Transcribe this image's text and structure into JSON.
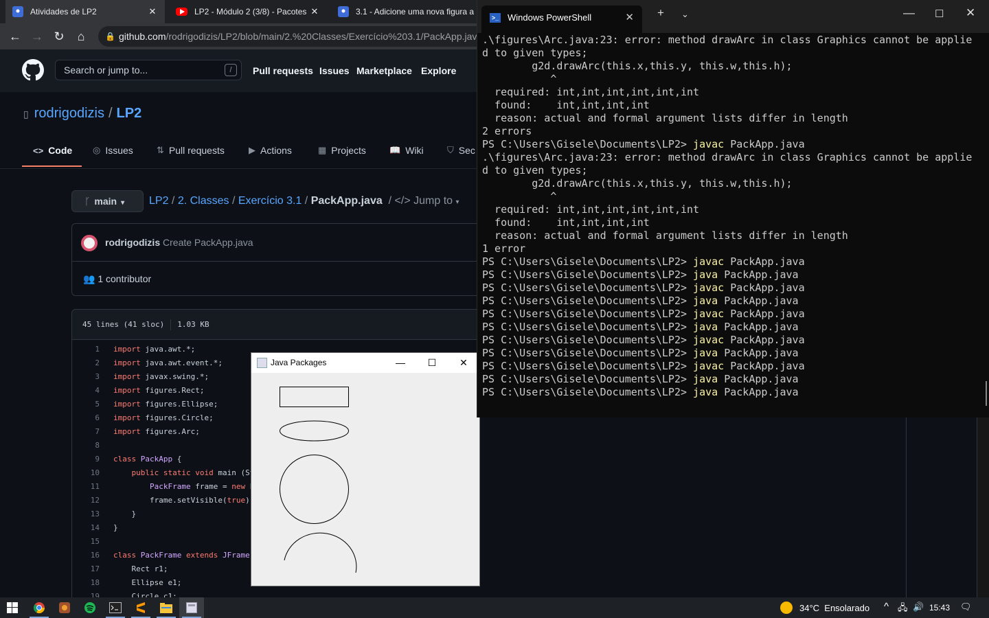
{
  "browser": {
    "tabs": [
      {
        "title": "Atividades de LP2",
        "active": true
      },
      {
        "title": "LP2 - Módulo 2 (3/8) - Pacotes e",
        "active": false
      },
      {
        "title": "3.1 - Adicione uma nova figura a",
        "active": false
      }
    ],
    "url_host": "github.com",
    "url_path": "/rodrigodizis/LP2/blob/main/2.%20Classes/Exercício%203.1/PackApp.java"
  },
  "github": {
    "search_placeholder": "Search or jump to...",
    "search_key": "/",
    "nav": [
      "Pull requests",
      "Issues",
      "Marketplace",
      "Explore"
    ],
    "repo_owner": "rodrigodizis",
    "repo_sep": "/",
    "repo_name": "LP2",
    "tabs": [
      "Code",
      "Issues",
      "Pull requests",
      "Actions",
      "Projects",
      "Wiki",
      "Sec"
    ],
    "branch": "main",
    "breadcrumb": {
      "root": "LP2",
      "dir1": "2. Classes",
      "dir2": "Exercício 3.1",
      "file": "PackApp.java",
      "jump": "Jump to"
    },
    "commit_author": "rodrigodizis",
    "commit_message": "Create PackApp.java",
    "contributors": "1 contributor",
    "file_lines": "45 lines (41 sloc)",
    "file_size": "1.03 KB",
    "code": [
      {
        "n": "1",
        "t": "import java.awt.*;"
      },
      {
        "n": "2",
        "t": "import java.awt.event.*;"
      },
      {
        "n": "3",
        "t": "import javax.swing.*;"
      },
      {
        "n": "4",
        "t": "import figures.Rect;"
      },
      {
        "n": "5",
        "t": "import figures.Ellipse;"
      },
      {
        "n": "6",
        "t": "import figures.Circle;"
      },
      {
        "n": "7",
        "t": "import figures.Arc;"
      },
      {
        "n": "8",
        "t": ""
      },
      {
        "n": "9",
        "t": "class PackApp {"
      },
      {
        "n": "10",
        "t": "    public static void main (St"
      },
      {
        "n": "11",
        "t": "        PackFrame frame = new P"
      },
      {
        "n": "12",
        "t": "        frame.setVisible(true)"
      },
      {
        "n": "13",
        "t": "    }"
      },
      {
        "n": "14",
        "t": "}"
      },
      {
        "n": "15",
        "t": ""
      },
      {
        "n": "16",
        "t": "class PackFrame extends JFrame"
      },
      {
        "n": "17",
        "t": "    Rect r1;"
      },
      {
        "n": "18",
        "t": "    Ellipse e1;"
      },
      {
        "n": "19",
        "t": "    Circle c1;"
      }
    ]
  },
  "java_window": {
    "title": "Java Packages"
  },
  "powershell": {
    "tab_title": "Windows PowerShell",
    "lines": [
      {
        "t": ".\\figures\\Arc.java:23: error: method drawArc in class Graphics cannot be applie"
      },
      {
        "t": "d to given types;"
      },
      {
        "t": "        g2d.drawArc(this.x,this.y, this.w,this.h);"
      },
      {
        "t": "           ^"
      },
      {
        "t": "  required: int,int,int,int,int,int"
      },
      {
        "t": "  found:    int,int,int,int"
      },
      {
        "t": "  reason: actual and formal argument lists differ in length"
      },
      {
        "t": "2 errors"
      },
      {
        "p": "PS C:\\Users\\Gisele\\Documents\\LP2> ",
        "c": "javac",
        "a": " PackApp.java"
      },
      {
        "t": ".\\figures\\Arc.java:23: error: method drawArc in class Graphics cannot be applie"
      },
      {
        "t": "d to given types;"
      },
      {
        "t": "        g2d.drawArc(this.x,this.y, this.w,this.h);"
      },
      {
        "t": "           ^"
      },
      {
        "t": "  required: int,int,int,int,int,int"
      },
      {
        "t": "  found:    int,int,int,int"
      },
      {
        "t": "  reason: actual and formal argument lists differ in length"
      },
      {
        "t": "1 error"
      },
      {
        "p": "PS C:\\Users\\Gisele\\Documents\\LP2> ",
        "c": "javac",
        "a": " PackApp.java"
      },
      {
        "p": "PS C:\\Users\\Gisele\\Documents\\LP2> ",
        "c": "java",
        "a": " PackApp.java"
      },
      {
        "p": "PS C:\\Users\\Gisele\\Documents\\LP2> ",
        "c": "javac",
        "a": " PackApp.java"
      },
      {
        "p": "PS C:\\Users\\Gisele\\Documents\\LP2> ",
        "c": "java",
        "a": " PackApp.java"
      },
      {
        "p": "PS C:\\Users\\Gisele\\Documents\\LP2> ",
        "c": "javac",
        "a": " PackApp.java"
      },
      {
        "p": "PS C:\\Users\\Gisele\\Documents\\LP2> ",
        "c": "java",
        "a": " PackApp.java"
      },
      {
        "p": "PS C:\\Users\\Gisele\\Documents\\LP2> ",
        "c": "javac",
        "a": " PackApp.java"
      },
      {
        "p": "PS C:\\Users\\Gisele\\Documents\\LP2> ",
        "c": "java",
        "a": " PackApp.java"
      },
      {
        "p": "PS C:\\Users\\Gisele\\Documents\\LP2> ",
        "c": "javac",
        "a": " PackApp.java"
      },
      {
        "p": "PS C:\\Users\\Gisele\\Documents\\LP2> ",
        "c": "java",
        "a": " PackApp.java"
      },
      {
        "p": "PS C:\\Users\\Gisele\\Documents\\LP2> ",
        "c": "java",
        "a": " PackApp.java"
      }
    ]
  },
  "taskbar": {
    "weather_temp": "34°C",
    "weather_desc": "Ensolarado",
    "time": "15:43"
  },
  "colors": {
    "github_bg": "#0d1117",
    "github_link": "#58a6ff",
    "active_tab_underline": "#f78166",
    "ps_command": "#f9f1a5"
  }
}
